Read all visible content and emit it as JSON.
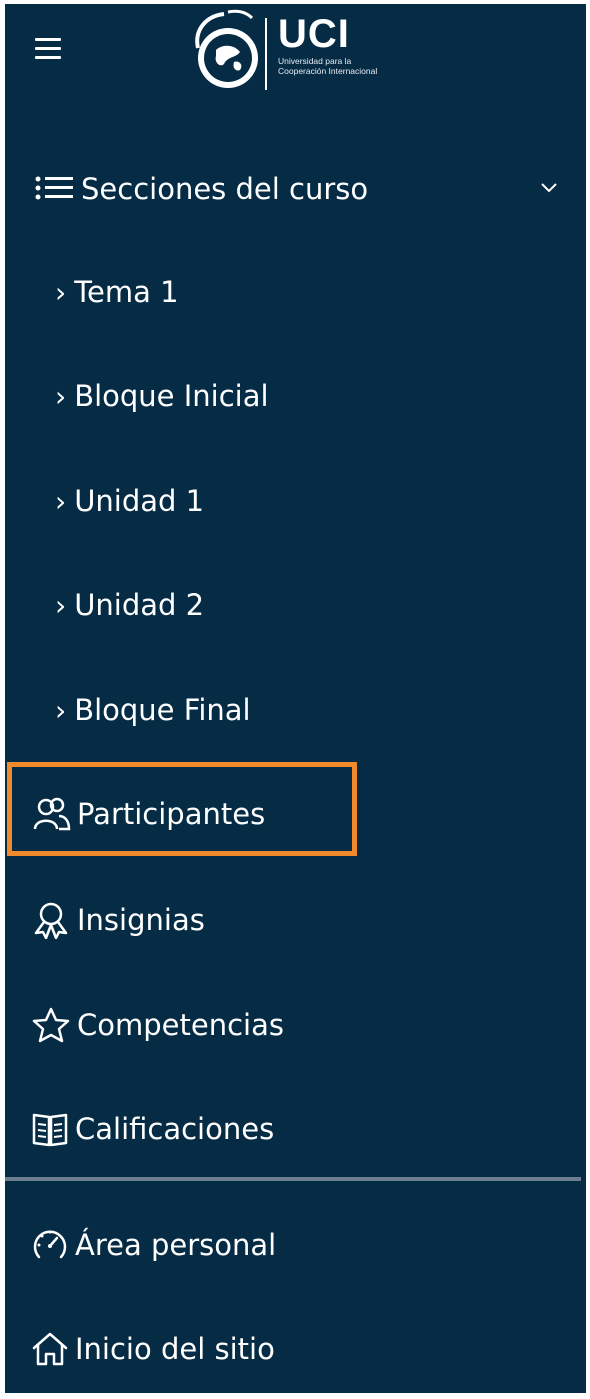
{
  "header": {
    "logo_title": "UCI",
    "logo_sub_1": "Universidad para la",
    "logo_sub_2": "Cooperación Internacional"
  },
  "nav": {
    "sections_label": "Secciones del curso",
    "subitems": [
      "Tema 1",
      "Bloque Inicial",
      "Unidad 1",
      "Unidad 2",
      "Bloque Final"
    ],
    "participants": "Participantes",
    "badges": "Insignias",
    "competencies": "Competencias",
    "grades": "Calificaciones",
    "dashboard": "Área personal",
    "site_home": "Inicio del sitio"
  },
  "icons": {
    "menu": "hamburger-icon",
    "sections": "list-icon",
    "expand": "chevron-down-icon",
    "subitem": "chevron-right-icon",
    "participants": "users-icon",
    "badges": "award-icon",
    "competencies": "star-icon",
    "grades": "gradebook-icon",
    "dashboard": "dashboard-icon",
    "site_home": "home-icon"
  },
  "colors": {
    "background": "#052b45",
    "text": "#ffffff",
    "highlight": "#f08a2b",
    "divider": "#6b7f8f"
  },
  "selected_item": "Participantes"
}
